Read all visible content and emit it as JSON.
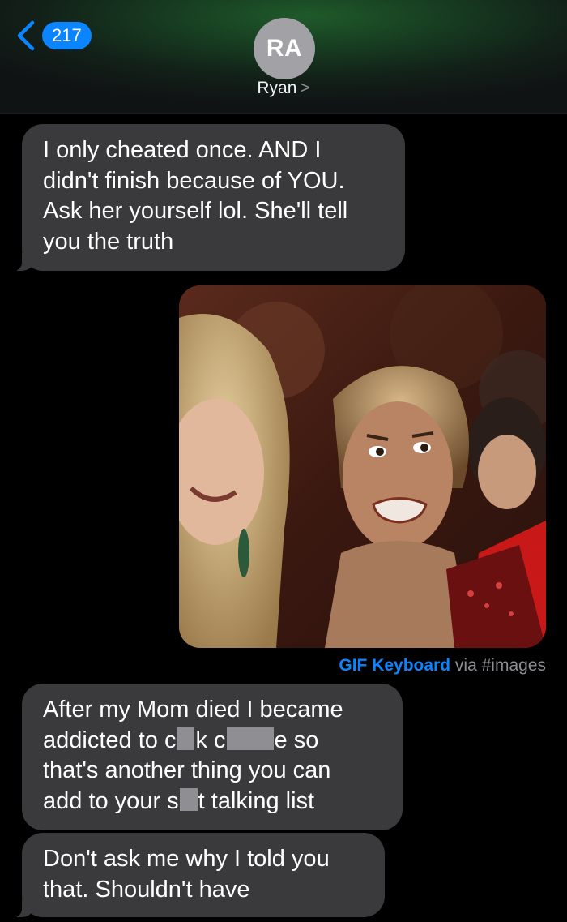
{
  "header": {
    "unread_count": "217",
    "avatar_initials": "RA",
    "contact_name": "Ryan",
    "contact_chevron": ">"
  },
  "messages": [
    {
      "lines": [
        "I only cheated once. AND I",
        "didn't finish because of YOU.",
        "Ask her yourself lol. She'll tell",
        "you the truth"
      ]
    },
    {
      "gif": true,
      "caption_source": "GIF Keyboard",
      "caption_via": "via",
      "caption_tag": "#images"
    },
    {
      "line1": "After my Mom died I became",
      "line2_a": "addicted to c",
      "line2_b": "k c",
      "line2_c": "e so",
      "line3": "that's another thing you can",
      "line4_a": "add to your s",
      "line4_b": "t talking list"
    },
    {
      "lines": [
        "Don't ask me why I told you",
        "that. Shouldn't have"
      ]
    }
  ],
  "colors": {
    "bubble_received": "#3a3a3c",
    "accent": "#0a84ff",
    "background": "#000000"
  }
}
